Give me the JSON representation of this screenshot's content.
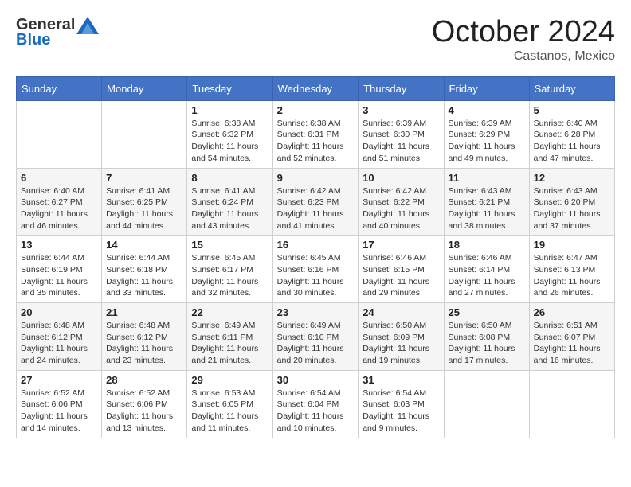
{
  "logo": {
    "general": "General",
    "blue": "Blue"
  },
  "header": {
    "month": "October 2024",
    "location": "Castanos, Mexico"
  },
  "days_of_week": [
    "Sunday",
    "Monday",
    "Tuesday",
    "Wednesday",
    "Thursday",
    "Friday",
    "Saturday"
  ],
  "weeks": [
    [
      {
        "day": "",
        "info": ""
      },
      {
        "day": "",
        "info": ""
      },
      {
        "day": "1",
        "info": "Sunrise: 6:38 AM\nSunset: 6:32 PM\nDaylight: 11 hours and 54 minutes."
      },
      {
        "day": "2",
        "info": "Sunrise: 6:38 AM\nSunset: 6:31 PM\nDaylight: 11 hours and 52 minutes."
      },
      {
        "day": "3",
        "info": "Sunrise: 6:39 AM\nSunset: 6:30 PM\nDaylight: 11 hours and 51 minutes."
      },
      {
        "day": "4",
        "info": "Sunrise: 6:39 AM\nSunset: 6:29 PM\nDaylight: 11 hours and 49 minutes."
      },
      {
        "day": "5",
        "info": "Sunrise: 6:40 AM\nSunset: 6:28 PM\nDaylight: 11 hours and 47 minutes."
      }
    ],
    [
      {
        "day": "6",
        "info": "Sunrise: 6:40 AM\nSunset: 6:27 PM\nDaylight: 11 hours and 46 minutes."
      },
      {
        "day": "7",
        "info": "Sunrise: 6:41 AM\nSunset: 6:25 PM\nDaylight: 11 hours and 44 minutes."
      },
      {
        "day": "8",
        "info": "Sunrise: 6:41 AM\nSunset: 6:24 PM\nDaylight: 11 hours and 43 minutes."
      },
      {
        "day": "9",
        "info": "Sunrise: 6:42 AM\nSunset: 6:23 PM\nDaylight: 11 hours and 41 minutes."
      },
      {
        "day": "10",
        "info": "Sunrise: 6:42 AM\nSunset: 6:22 PM\nDaylight: 11 hours and 40 minutes."
      },
      {
        "day": "11",
        "info": "Sunrise: 6:43 AM\nSunset: 6:21 PM\nDaylight: 11 hours and 38 minutes."
      },
      {
        "day": "12",
        "info": "Sunrise: 6:43 AM\nSunset: 6:20 PM\nDaylight: 11 hours and 37 minutes."
      }
    ],
    [
      {
        "day": "13",
        "info": "Sunrise: 6:44 AM\nSunset: 6:19 PM\nDaylight: 11 hours and 35 minutes."
      },
      {
        "day": "14",
        "info": "Sunrise: 6:44 AM\nSunset: 6:18 PM\nDaylight: 11 hours and 33 minutes."
      },
      {
        "day": "15",
        "info": "Sunrise: 6:45 AM\nSunset: 6:17 PM\nDaylight: 11 hours and 32 minutes."
      },
      {
        "day": "16",
        "info": "Sunrise: 6:45 AM\nSunset: 6:16 PM\nDaylight: 11 hours and 30 minutes."
      },
      {
        "day": "17",
        "info": "Sunrise: 6:46 AM\nSunset: 6:15 PM\nDaylight: 11 hours and 29 minutes."
      },
      {
        "day": "18",
        "info": "Sunrise: 6:46 AM\nSunset: 6:14 PM\nDaylight: 11 hours and 27 minutes."
      },
      {
        "day": "19",
        "info": "Sunrise: 6:47 AM\nSunset: 6:13 PM\nDaylight: 11 hours and 26 minutes."
      }
    ],
    [
      {
        "day": "20",
        "info": "Sunrise: 6:48 AM\nSunset: 6:12 PM\nDaylight: 11 hours and 24 minutes."
      },
      {
        "day": "21",
        "info": "Sunrise: 6:48 AM\nSunset: 6:12 PM\nDaylight: 11 hours and 23 minutes."
      },
      {
        "day": "22",
        "info": "Sunrise: 6:49 AM\nSunset: 6:11 PM\nDaylight: 11 hours and 21 minutes."
      },
      {
        "day": "23",
        "info": "Sunrise: 6:49 AM\nSunset: 6:10 PM\nDaylight: 11 hours and 20 minutes."
      },
      {
        "day": "24",
        "info": "Sunrise: 6:50 AM\nSunset: 6:09 PM\nDaylight: 11 hours and 19 minutes."
      },
      {
        "day": "25",
        "info": "Sunrise: 6:50 AM\nSunset: 6:08 PM\nDaylight: 11 hours and 17 minutes."
      },
      {
        "day": "26",
        "info": "Sunrise: 6:51 AM\nSunset: 6:07 PM\nDaylight: 11 hours and 16 minutes."
      }
    ],
    [
      {
        "day": "27",
        "info": "Sunrise: 6:52 AM\nSunset: 6:06 PM\nDaylight: 11 hours and 14 minutes."
      },
      {
        "day": "28",
        "info": "Sunrise: 6:52 AM\nSunset: 6:06 PM\nDaylight: 11 hours and 13 minutes."
      },
      {
        "day": "29",
        "info": "Sunrise: 6:53 AM\nSunset: 6:05 PM\nDaylight: 11 hours and 11 minutes."
      },
      {
        "day": "30",
        "info": "Sunrise: 6:54 AM\nSunset: 6:04 PM\nDaylight: 11 hours and 10 minutes."
      },
      {
        "day": "31",
        "info": "Sunrise: 6:54 AM\nSunset: 6:03 PM\nDaylight: 11 hours and 9 minutes."
      },
      {
        "day": "",
        "info": ""
      },
      {
        "day": "",
        "info": ""
      }
    ]
  ]
}
